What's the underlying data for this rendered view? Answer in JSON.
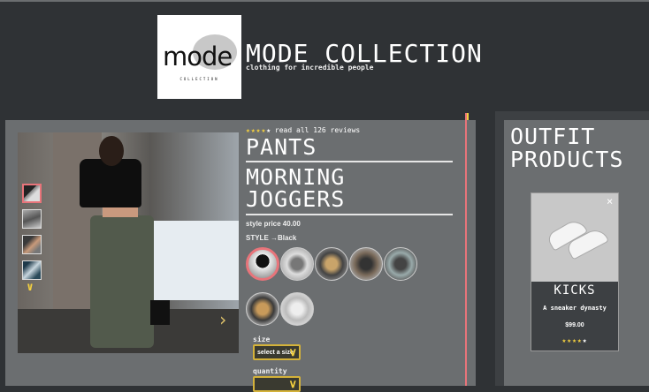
{
  "brand": {
    "logo_word": "mode",
    "logo_subtext": "COLLECTION",
    "title": "MODE COLLECTION",
    "tagline": "clothing for incredible people"
  },
  "product": {
    "rating": 4,
    "stars_filled": "★★★★",
    "stars_empty": "★",
    "reviews_link": "read all 126 reviews",
    "category": "PANTS",
    "name": "MORNING JOGGERS",
    "price_text": "style price 40.00",
    "style_text": "STYLE →Black",
    "swatch_count": 7,
    "thumbnail_count": 4
  },
  "options": {
    "size_label": "size",
    "size_value": "select a size",
    "quantity_label": "quantity",
    "quantity_value": ""
  },
  "outfit": {
    "title": "OUTFIT PRODUCTS",
    "card": {
      "name": "KICKS",
      "description": "A sneaker dynasty",
      "price": "$99.00",
      "stars_filled": "★★★★",
      "stars_empty": "★",
      "close": "×"
    }
  },
  "colors": {
    "accent": "#e8747a",
    "gold": "#f4d03f",
    "panel": "#6b6e70",
    "background": "#2f3235"
  },
  "icons": {
    "next": "chevron-right-icon",
    "thumb_down": "chevron-down-icon",
    "dropdown": "chevron-down-icon",
    "close": "close-icon"
  }
}
